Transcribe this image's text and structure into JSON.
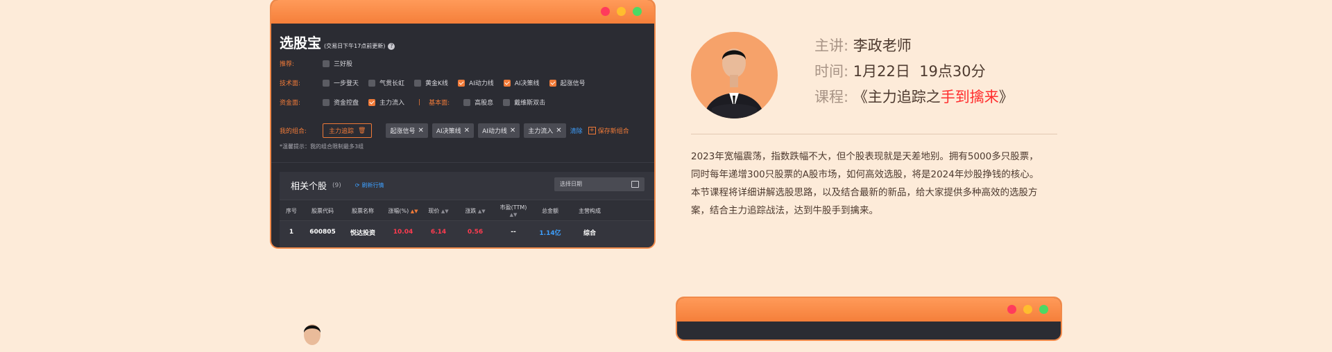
{
  "window1": {
    "title": "选股宝",
    "subtitle": "(交易日下午17点前更新)",
    "help": "?",
    "filters": {
      "recommend": {
        "label": "推荐:",
        "items": [
          {
            "label": "三好股",
            "checked": false
          }
        ]
      },
      "technical": {
        "label": "技术面:",
        "items": [
          {
            "label": "一步登天",
            "checked": false
          },
          {
            "label": "气贯长虹",
            "checked": false
          },
          {
            "label": "黄金K线",
            "checked": false
          },
          {
            "label": "AI动力线",
            "checked": true
          },
          {
            "label": "AI决策线",
            "checked": true
          },
          {
            "label": "起涨信号",
            "checked": true
          }
        ]
      },
      "capital": {
        "label": "资金面:",
        "items": [
          {
            "label": "资金控盘",
            "checked": false
          },
          {
            "label": "主力流入",
            "checked": true
          }
        ]
      },
      "fundamental": {
        "label": "基本面:",
        "items": [
          {
            "label": "高股息",
            "checked": false
          },
          {
            "label": "戴维斯双击",
            "checked": false
          }
        ]
      }
    },
    "combo": {
      "label": "我的组合:",
      "button": "主力追踪",
      "chips": [
        "起涨信号",
        "AI决策线",
        "AI动力线",
        "主力流入"
      ],
      "clear": "清除",
      "save": "保存新组合"
    },
    "tip": "*温馨提示：我的组合限制最多3组",
    "panel": {
      "title": "相关个股",
      "count": "(9)",
      "refresh": "刷新行情",
      "date_placeholder": "选择日期",
      "headers": [
        "序号",
        "股票代码",
        "股票名称",
        "涨幅(%)",
        "现价",
        "涨跌",
        "市盈(TTM)",
        "总金额",
        "主营构成"
      ],
      "rows": [
        [
          "1",
          "600805",
          "悦达投资",
          "10.04",
          "6.14",
          "0.56",
          "--",
          "1.14亿",
          "综合"
        ]
      ]
    }
  },
  "info": {
    "lecturer_label": "主讲:",
    "lecturer": "李政老师",
    "time_label": "时间:",
    "time": "1月22日  19点30分",
    "course_label": "课程:",
    "course_prefix": "《主力追踪之",
    "course_highlight": "手到擒来",
    "course_suffix": "》",
    "description": [
      "2023年宽幅震荡，指数跌幅不大，但个股表现就是天差地别。拥有5000多只股票，",
      "同时每年递增300只股票的A股市场，如何高效选股，将是2024年炒股挣钱的核心。",
      "本节课程将详细讲解选股思路，以及结合最新的新品，给大家提供多种高效的选股方",
      "案，结合主力追踪战法，达到牛股手到擒来。"
    ]
  },
  "colors": {
    "accent": "#f07a38",
    "highlight": "#ff2d2d",
    "background": "#fdebd9"
  }
}
